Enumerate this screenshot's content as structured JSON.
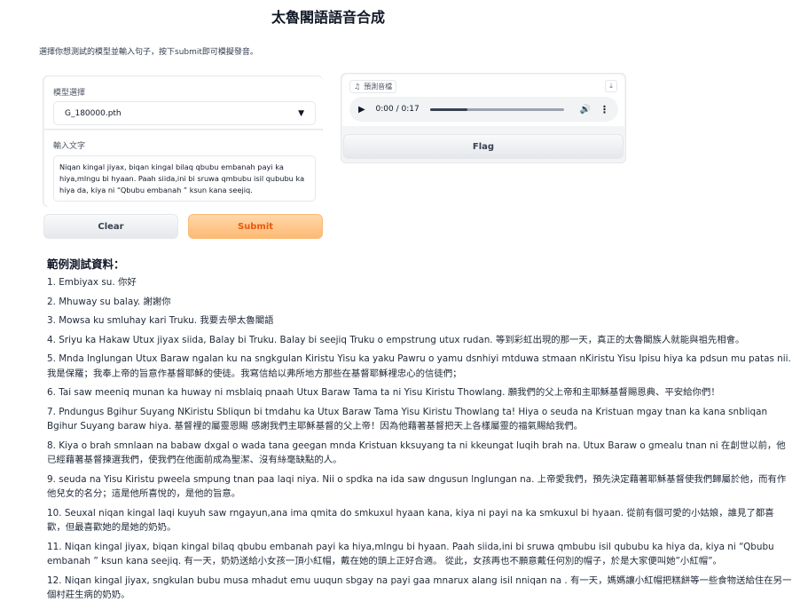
{
  "header": {
    "title": "太魯閣語語音合成",
    "subtitle": "選擇你想測試的模型並輸入句子，按下submit即可模擬發音。"
  },
  "model": {
    "label": "模型選擇",
    "selected": "G_180000.pth"
  },
  "input": {
    "label": "輸入文字",
    "value": "Niqan kingal jiyax, biqan kingal bilaq qbubu embanah payi ka hiya,mlngu bi hyaan. Paah siida,ini bi sruwa qmbubu isil qububu ka hiya da, kiya ni “Qbubu embanah ” ksun kana seejiq."
  },
  "buttons": {
    "clear": "Clear",
    "submit": "Submit",
    "flag": "Flag"
  },
  "audio": {
    "label": "預測音檔",
    "time": "0:00 / 0:17",
    "progress": 0.28
  },
  "examples": {
    "title": "範例測試資料：",
    "items": [
      "1. Embiyax su. 你好",
      "2. Mhuway su balay. 謝謝你",
      "3. Mowsa ku smluhay kari Truku. 我要去學太魯閣語",
      "4. Sriyu ka Hakaw Utux jiyax siida, Balay bi Truku. Balay bi seejiq Truku o empstrung utux rudan. 等到彩虹出現的那一天，真正的太魯閣族人就能與祖先相會。",
      "5. Mnda lnglungan Utux Baraw ngalan ku na sngkgulan Kiristu Yisu ka yaku Pawru o yamu dsnhiyi mtduwa stmaan nKiristu Yisu Ipisu hiya ka pdsun mu patas nii. 我是保羅；我奉上帝的旨意作基督耶穌的使徒。我寫信給以弗所地方那些在基督耶穌裡忠心的信徒們；",
      "6. Tai saw meeniq munan ka huway ni msblaiq pnaah Utux Baraw Tama ta ni Yisu Kiristu Thowlang. 願我們的父上帝和主耶穌基督賜恩典、平安給你們！",
      "7. Pndungus Bgihur Suyang NKiristu Sbliqun bi tmdahu ka Utux Baraw Tama Yisu Kiristu Thowlang ta! Hiya o seuda na Kristuan mgay tnan ka kana snbliqan Bgihur Suyang baraw hiya. 基督裡的屬靈恩賜 感謝我們主耶穌基督的父上帝！因為他藉著基督把天上各樣屬靈的福氣賜給我們。",
      "8. Kiya o brah smnlaan na babaw dxgal o wada tana geegan mnda Kristuan kksuyang ta ni kkeungat luqih brah na. Utux Baraw o gmealu tnan ni 在創世以前，他已經藉著基督揀選我們，使我們在他面前成為聖潔、沒有絲毫缺點的人。",
      "9. seuda na Yisu Kiristu pweela smpung tnan paa laqi niya. Nii o spdka na ida saw dngusun lnglungan na. 上帝愛我們，預先決定藉著耶穌基督使我們歸屬於他，而有作他兒女的名分；這是他所喜悅的，是他的旨意。",
      "10. Seuxal niqan kingal laqi kuyuh saw rngayun,ana ima qmita do smkuxul hyaan kana, kiya ni payi na ka smkuxul bi hyaan. 從前有個可愛的小姑娘，誰見了都喜歡，但最喜歡她的是她的奶奶。",
      "11. Niqan kingal jiyax, biqan kingal bilaq qbubu embanah payi ka hiya,mlngu bi hyaan. Paah siida,ini bi sruwa qmbubu isil qububu ka hiya da, kiya ni “Qbubu embanah ” ksun kana seejiq. 有一天，奶奶送給小女孩一頂小紅帽，戴在她的頭上正好合適。 從此，女孩再也不願意戴任何別的帽子，於是大家便叫她”小紅帽”。",
      "12. Niqan kingal jiyax, sngkulan bubu musa mhadut emu uuqun sbgay na payi gaa mnarux alang isil nniqan na . 有一天，媽媽讓小紅帽把糕餅等一些食物送給住在另一個村莊生病的奶奶。"
    ]
  }
}
